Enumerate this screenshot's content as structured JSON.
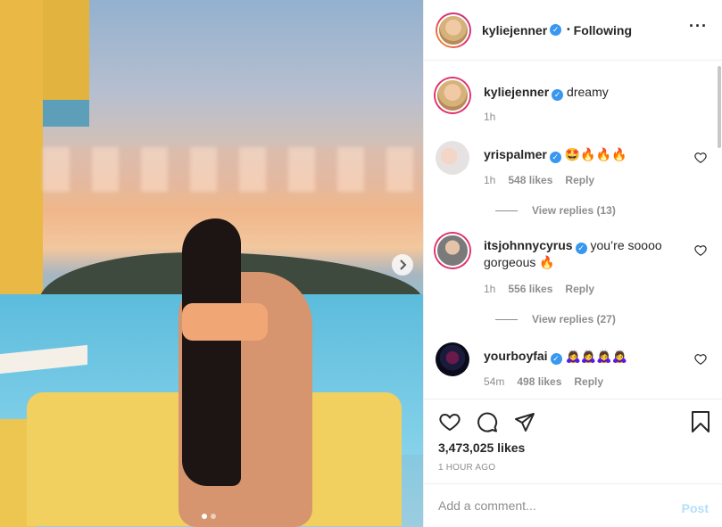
{
  "post": {
    "author": "kyliejenner",
    "follow_separator": "•",
    "follow_status": "Following",
    "more_icon": "more-horizontal-icon"
  },
  "photo": {
    "next_icon": "chevron-right-icon",
    "carousel_count": 2,
    "carousel_active": 1
  },
  "caption": {
    "username": "kyliejenner",
    "text": "dreamy",
    "time": "1h"
  },
  "comments": [
    {
      "username": "yrispalmer",
      "text": "🤩🔥🔥🔥",
      "time": "1h",
      "likes": "548 likes",
      "reply": "Reply",
      "view_replies": "View replies (13)"
    },
    {
      "username": "itsjohnnycyrus",
      "text": "you’re soooo gorgeous 🔥",
      "time": "1h",
      "likes": "556 likes",
      "reply": "Reply",
      "view_replies": "View replies (27)"
    },
    {
      "username": "yourboyfai",
      "text": "🙇‍♀️🙇‍♀️🙇‍♀️🙇‍♀️",
      "time": "54m",
      "likes": "498 likes",
      "reply": "Reply"
    }
  ],
  "actions": {
    "like_icon": "heart-icon",
    "comment_icon": "comment-icon",
    "share_icon": "share-icon",
    "save_icon": "bookmark-icon"
  },
  "likes_count": "3,473,025 likes",
  "posted": "1 HOUR AGO",
  "add_comment": {
    "placeholder": "Add a comment...",
    "post_label": "Post"
  },
  "colors": {
    "verified": "#3897f0",
    "post_disabled": "#b2dffc",
    "muted": "#8e8e8e"
  }
}
